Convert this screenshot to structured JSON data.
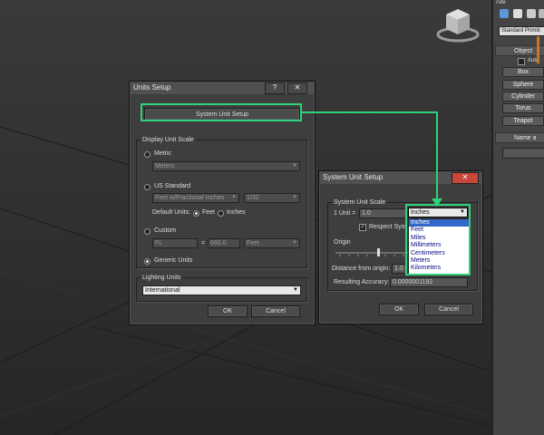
{
  "colors": {
    "highlight": "#2fd17a",
    "accent_orange": "#c8762a",
    "selection": "#3367c8"
  },
  "command_panel": {
    "top_text": "7ufe",
    "primitive_select": "Standard Primiti",
    "object_type_header": "Object",
    "autogrid_label": "Auto",
    "objects": [
      "Box",
      "Sphere",
      "Cylinder",
      "Torus",
      "Teapot"
    ],
    "name_header": "Name a"
  },
  "units_setup": {
    "title": "Units Setup",
    "help_label": "?",
    "close_label": "✕",
    "system_unit_setup_button": "System Unit Setup",
    "display_group": "Display Unit Scale",
    "metric_label": "Metric",
    "metric_value": "Meters",
    "us_label": "US Standard",
    "us_value": "Feet w/Fractional Inches",
    "fraction_value": "1/32",
    "default_units_label": "Default Units:",
    "feet_label": "Feet",
    "inches_label": "Inches",
    "custom_label": "Custom",
    "custom_name": "FL",
    "custom_equals": "=",
    "custom_value": "660.0",
    "custom_unit": "Feet",
    "generic_label": "Generic Units",
    "lighting_group": "Lighting Units",
    "lighting_value": "International",
    "ok_label": "OK",
    "cancel_label": "Cancel"
  },
  "system_unit_setup": {
    "title": "System Unit Setup",
    "close_label": "✕",
    "scale_group": "System Unit Scale",
    "unit_label": "1 Unit =",
    "unit_value": "1.0",
    "unit_selected": "Inches",
    "respect_label": "Respect Syst",
    "origin_group": "Origin",
    "distance_label": "Distance from origin:",
    "distance_value": "1.0",
    "accuracy_label": "Resulting Accuracy:",
    "accuracy_value": "0.0000001192",
    "options": [
      "Inches",
      "Feet",
      "Miles",
      "Millimeters",
      "Centimeters",
      "Meters",
      "Kilometers"
    ],
    "ok_label": "OK",
    "cancel_label": "Cancel"
  }
}
